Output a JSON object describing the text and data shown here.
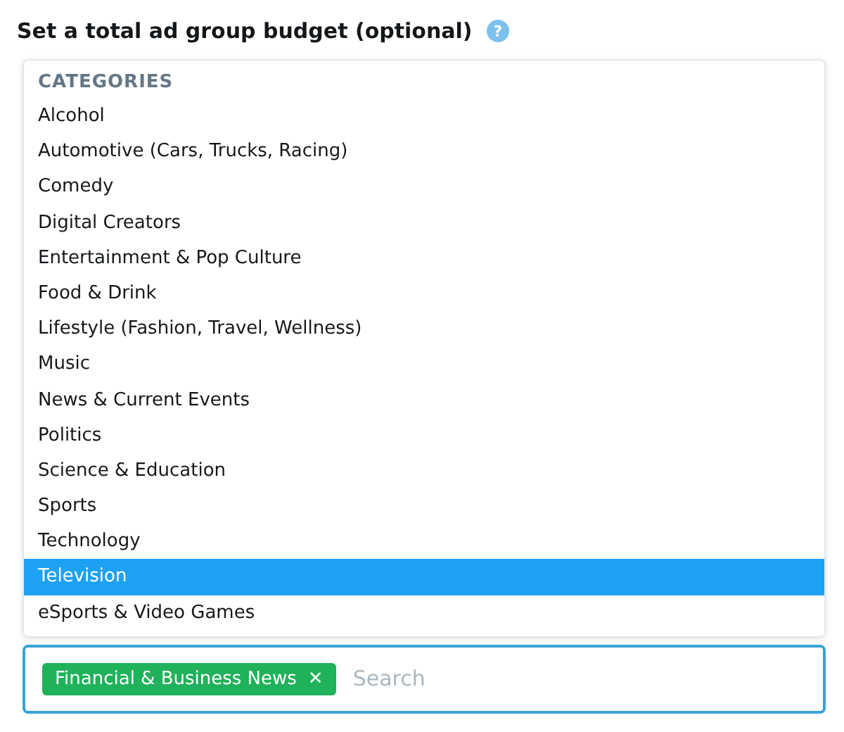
{
  "title": "Set a total ad group budget (optional)",
  "help": "?",
  "dropdown": {
    "header": "CATEGORIES",
    "items": [
      {
        "label": "Alcohol",
        "selected": false
      },
      {
        "label": "Automotive (Cars, Trucks, Racing)",
        "selected": false
      },
      {
        "label": "Comedy",
        "selected": false
      },
      {
        "label": "Digital Creators",
        "selected": false
      },
      {
        "label": "Entertainment & Pop Culture",
        "selected": false
      },
      {
        "label": "Food & Drink",
        "selected": false
      },
      {
        "label": "Lifestyle (Fashion, Travel, Wellness)",
        "selected": false
      },
      {
        "label": "Music",
        "selected": false
      },
      {
        "label": "News & Current Events",
        "selected": false
      },
      {
        "label": "Politics",
        "selected": false
      },
      {
        "label": "Science & Education",
        "selected": false
      },
      {
        "label": "Sports",
        "selected": false
      },
      {
        "label": "Technology",
        "selected": false
      },
      {
        "label": "Television",
        "selected": true
      },
      {
        "label": "eSports & Video Games",
        "selected": false
      }
    ]
  },
  "field": {
    "tags": [
      {
        "label": "Financial & Business News",
        "remove": "✕"
      }
    ],
    "placeholder": "Search"
  }
}
